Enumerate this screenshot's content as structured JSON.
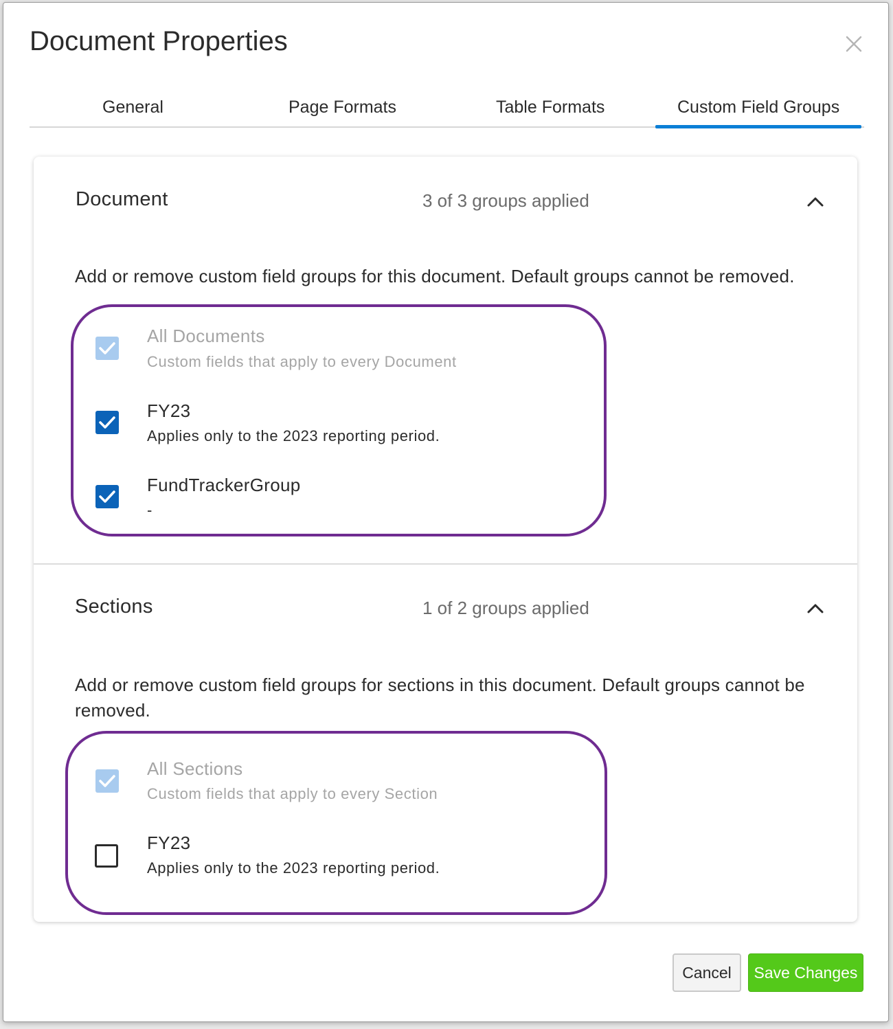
{
  "dialog": {
    "title": "Document Properties",
    "close_icon": "close-icon"
  },
  "tabs": [
    {
      "label": "General",
      "active": false
    },
    {
      "label": "Page Formats",
      "active": false
    },
    {
      "label": "Table Formats",
      "active": false
    },
    {
      "label": "Custom Field Groups",
      "active": true
    }
  ],
  "document_section": {
    "title": "Document",
    "count": "3 of 3 groups applied",
    "expanded": true,
    "description": "Add or remove custom field groups for this document. Default groups cannot be removed.",
    "items": [
      {
        "name": "All Documents",
        "description": "Custom fields that apply to every Document",
        "checked": true,
        "disabled": true
      },
      {
        "name": "FY23",
        "description": "Applies only to the 2023 reporting period.",
        "checked": true,
        "disabled": false
      },
      {
        "name": "FundTrackerGroup",
        "description": "-",
        "checked": true,
        "disabled": false
      }
    ]
  },
  "sections_section": {
    "title": "Sections",
    "count": "1 of 2 groups applied",
    "expanded": true,
    "description": "Add or remove custom field groups for sections in this document. Default groups cannot be removed.",
    "items": [
      {
        "name": "All Sections",
        "description": "Custom fields that apply to every Section",
        "checked": true,
        "disabled": true
      },
      {
        "name": "FY23",
        "description": "Applies only to the 2023 reporting period.",
        "checked": false,
        "disabled": false
      }
    ]
  },
  "footer": {
    "cancel_label": "Cancel",
    "save_label": "Save Changes"
  },
  "colors": {
    "accent_tab": "#0b7fd6",
    "checkbox_checked": "#0b63b8",
    "checkbox_disabled": "#a8cbef",
    "highlight_outline": "#6f2c91",
    "save_button": "#54c91a"
  }
}
